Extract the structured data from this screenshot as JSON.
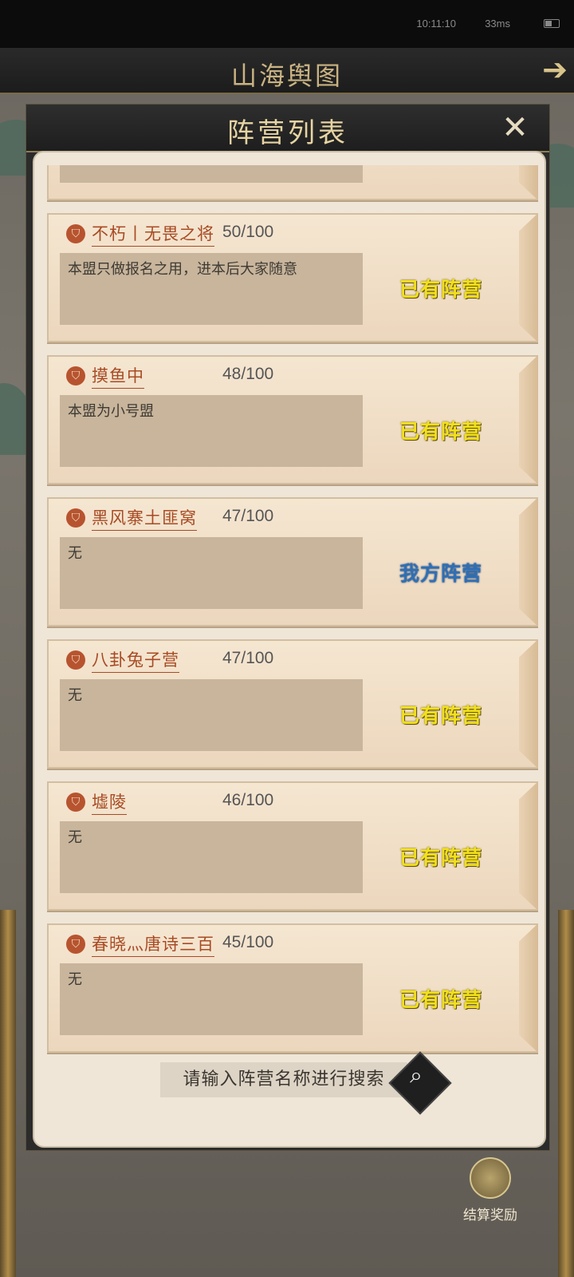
{
  "status_bar": {
    "time": "10:11:10",
    "network": "33ms"
  },
  "map_header": {
    "title": "山海舆图"
  },
  "modal": {
    "title": "阵营列表"
  },
  "camps": [
    {
      "name": "不朽丨无畏之将",
      "count": "50/100",
      "description": "本盟只做报名之用，进本后大家随意",
      "status": "已有阵营",
      "status_type": "other"
    },
    {
      "name": "摸鱼中",
      "count": "48/100",
      "description": "本盟为小号盟",
      "status": "已有阵营",
      "status_type": "other"
    },
    {
      "name": "黑风寨土匪窝",
      "count": "47/100",
      "description": "无",
      "status": "我方阵营",
      "status_type": "mine"
    },
    {
      "name": "八卦兔子营",
      "count": "47/100",
      "description": "无",
      "status": "已有阵营",
      "status_type": "other"
    },
    {
      "name": "墟陵",
      "count": "46/100",
      "description": "无",
      "status": "已有阵营",
      "status_type": "other"
    },
    {
      "name": "春晓灬唐诗三百",
      "count": "45/100",
      "description": "无",
      "status": "已有阵营",
      "status_type": "other"
    }
  ],
  "search": {
    "placeholder": "请输入阵营名称进行搜索"
  },
  "footer": {
    "reward_label": "结算奖励"
  },
  "colors": {
    "status_other": "#f1e01c",
    "status_mine": "#2e6fb6",
    "camp_name": "#a74b24"
  }
}
